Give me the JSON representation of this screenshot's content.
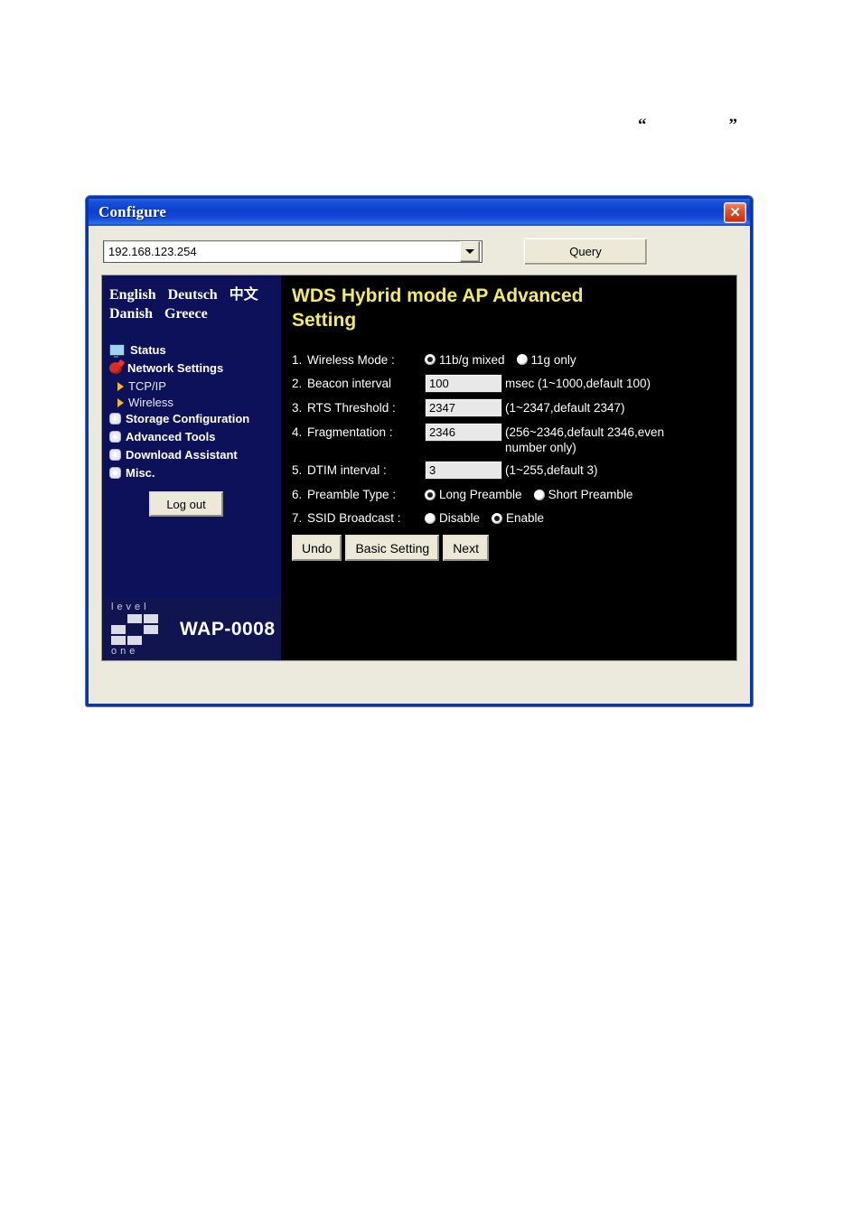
{
  "page": {
    "quote_open": "“",
    "quote_close": "”"
  },
  "window": {
    "title": "Configure",
    "close_label": "✕"
  },
  "toolbar": {
    "address_value": "192.168.123.254",
    "address_placeholder": "192.168.123.254",
    "query_label": "Query"
  },
  "sidebar": {
    "languages_row1": [
      "English",
      "Deutsch",
      "中文"
    ],
    "languages_row2": [
      "Danish",
      "Greece"
    ],
    "nav": [
      {
        "label": "Status",
        "icon": "monitor-icon",
        "sub": false
      },
      {
        "label": "Network Settings",
        "icon": "globe-icon",
        "sub": false
      },
      {
        "label": "TCP/IP",
        "icon": "triangle-bullet-icon",
        "sub": true
      },
      {
        "label": "Wireless",
        "icon": "triangle-bullet-icon",
        "sub": true
      },
      {
        "label": "Storage Configuration",
        "icon": "gear-bullet-icon",
        "sub": false
      },
      {
        "label": "Advanced Tools",
        "icon": "gear-bullet-icon",
        "sub": false
      },
      {
        "label": "Download Assistant",
        "icon": "gear-bullet-icon",
        "sub": false
      },
      {
        "label": "Misc.",
        "icon": "gear-bullet-icon",
        "sub": false
      }
    ],
    "logout_label": "Log out",
    "brand": {
      "word_top": "level",
      "word_bottom": "one",
      "model": "WAP-0008"
    }
  },
  "main": {
    "title": "WDS Hybrid mode AP Advanced Setting",
    "rows": [
      {
        "num": "1.",
        "label": "Wireless Mode :",
        "type": "radio",
        "options": [
          {
            "label": "11b/g mixed",
            "selected": true
          },
          {
            "label": "11g only",
            "selected": false
          }
        ]
      },
      {
        "num": "2.",
        "label": "Beacon interval",
        "type": "text",
        "value": "100",
        "hint": "msec (1~1000,default 100)"
      },
      {
        "num": "3.",
        "label": "RTS Threshold :",
        "type": "text",
        "value": "2347",
        "hint": "(1~2347,default 2347)"
      },
      {
        "num": "4.",
        "label": "Fragmentation :",
        "type": "text",
        "value": "2346",
        "hint": "(256~2346,default 2346,even number only)"
      },
      {
        "num": "5.",
        "label": "DTIM interval :",
        "type": "text",
        "value": "3",
        "hint": "(1~255,default 3)"
      },
      {
        "num": "6.",
        "label": "Preamble Type :",
        "type": "radio",
        "options": [
          {
            "label": "Long Preamble",
            "selected": true
          },
          {
            "label": "Short Preamble",
            "selected": false
          }
        ]
      },
      {
        "num": "7.",
        "label": "SSID Broadcast :",
        "type": "radio",
        "options": [
          {
            "label": "Disable",
            "selected": false
          },
          {
            "label": "Enable",
            "selected": true
          }
        ]
      }
    ],
    "buttons": [
      {
        "label": "Undo"
      },
      {
        "label": "Basic Setting"
      },
      {
        "label": "Next"
      }
    ]
  },
  "colors": {
    "title_bar": "#0d3fcf",
    "accent_yellow": "#f2e96a",
    "sidebar_navy": "#0d1159",
    "content_black": "#000000",
    "dialog_face": "#eceadd"
  }
}
